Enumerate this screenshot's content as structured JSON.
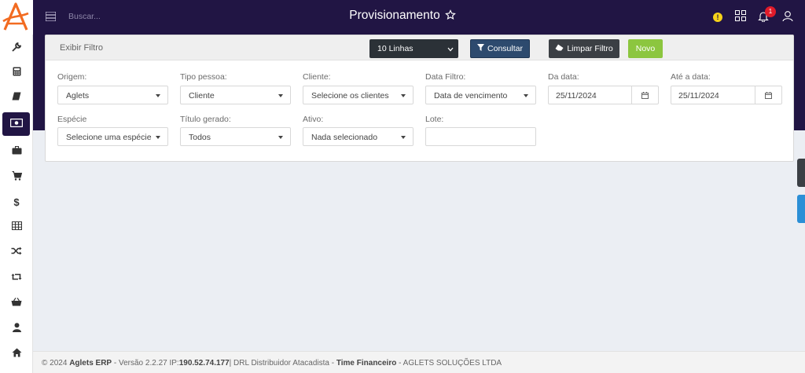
{
  "topbar": {
    "search_placeholder": "Buscar...",
    "title": "Provisionamento",
    "warning_symbol": "!",
    "notification_count": "1"
  },
  "sidebar": {
    "items": [
      {
        "icon": "wrench-icon"
      },
      {
        "icon": "calculator-icon"
      },
      {
        "icon": "book-icon"
      },
      {
        "icon": "money-icon",
        "active": true
      },
      {
        "icon": "briefcase-icon"
      },
      {
        "icon": "cart-icon"
      },
      {
        "icon": "dollar-icon"
      },
      {
        "icon": "table-icon"
      },
      {
        "icon": "shuffle-icon"
      },
      {
        "icon": "retweet-icon"
      },
      {
        "icon": "basket-icon"
      },
      {
        "icon": "user-icon"
      },
      {
        "icon": "home-icon"
      }
    ]
  },
  "filter": {
    "panel_title": "Exibir Filtro",
    "lines_select": "10 Linhas",
    "consultar_label": "Consultar",
    "limpar_label": "Limpar Filtro",
    "novo_label": "Novo",
    "origem_label": "Origem:",
    "origem_value": "Aglets",
    "tipo_pessoa_label": "Tipo pessoa:",
    "tipo_pessoa_value": "Cliente",
    "cliente_label": "Cliente:",
    "cliente_value": "Selecione os clientes",
    "data_filtro_label": "Data Filtro:",
    "data_filtro_value": "Data de vencimento",
    "da_data_label": "Da data:",
    "da_data_value": "25/11/2024",
    "ate_data_label": "Até a data:",
    "ate_data_value": "25/11/2024",
    "especie_label": "Espécie",
    "especie_value": "Selecione uma espécie",
    "titulo_label": "Título gerado:",
    "titulo_value": "Todos",
    "ativo_label": "Ativo:",
    "ativo_value": "Nada selecionado",
    "lote_label": "Lote:",
    "lote_value": ""
  },
  "footer": {
    "copyright": "© 2024",
    "product": "Aglets ERP",
    "version": "- Versão 2.2.27  IP:",
    "ip": "190.52.74.177",
    "company": "| DRL Distribuidor Atacadista -",
    "team": "Time Financeiro",
    "vendor": "- AGLETS SOLUÇÕES LTDA"
  },
  "colors": {
    "brand_dark": "#211544",
    "accent_orange": "#f26b21",
    "consultar_blue": "#2d4a6e",
    "novo_green": "#8cc63f",
    "badge_red": "#e01b2a"
  }
}
